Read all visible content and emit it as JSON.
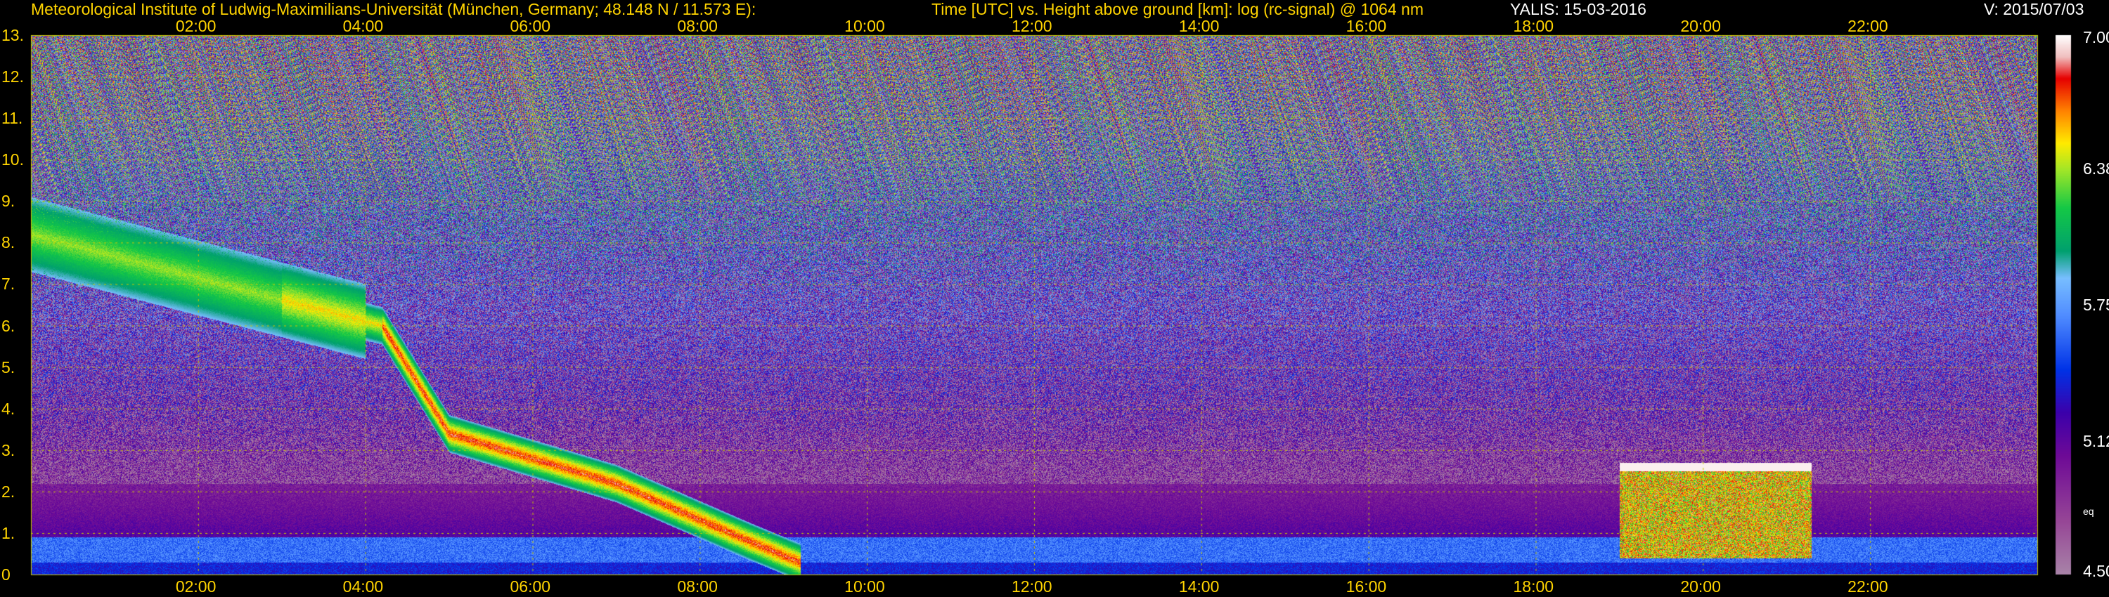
{
  "header": {
    "institute": "Meteorological Institute of Ludwig-Maximilians-Universität (München, Germany; 48.148 N / 11.573 E):",
    "plot_desc": "Time [UTC] vs. Height above ground [km]: log (rc-signal) @ 1064 nm",
    "instrument": "YALIS: 15-03-2016",
    "version": "V: 2015/07/03"
  },
  "colors": {
    "annotation": "#ffd400",
    "grid": "#c8c800",
    "background": "#000000"
  },
  "chart_data": {
    "type": "heatmap",
    "x_unit": "UTC hour",
    "y_unit": "km",
    "xlim": [
      0,
      24
    ],
    "ylim": [
      0,
      13
    ],
    "x_ticks": [
      2,
      4,
      6,
      8,
      10,
      12,
      14,
      16,
      18,
      20,
      22
    ],
    "x_tick_labels": [
      "02:00",
      "04:00",
      "06:00",
      "08:00",
      "10:00",
      "12:00",
      "14:00",
      "16:00",
      "18:00",
      "20:00",
      "22:00"
    ],
    "y_ticks": [
      0,
      1,
      2,
      3,
      4,
      5,
      6,
      7,
      8,
      9,
      10,
      11,
      12,
      13
    ],
    "y_tick_labels": [
      "0",
      "1.",
      "2.",
      "3.",
      "4.",
      "5.",
      "6.",
      "7.",
      "8.",
      "9.",
      "10.",
      "11.",
      "12.",
      "13."
    ],
    "grid": true,
    "colorbar": {
      "range": [
        4.5,
        7.0
      ],
      "tick_values": [
        7.0,
        6.38,
        5.75,
        5.12,
        4.5
      ],
      "tick_labels": [
        "7.00",
        "6.38",
        "5.75",
        "5.12",
        "4.50"
      ],
      "unit_label": "eq"
    },
    "features": [
      {
        "kind": "descending_layer",
        "time": [
          0.0,
          4.2,
          5.0,
          6.0,
          7.0,
          7.8,
          8.6,
          9.2
        ],
        "height_km": [
          8.2,
          6.0,
          3.4,
          2.8,
          2.2,
          1.5,
          0.8,
          0.3
        ]
      },
      {
        "kind": "near_surface_layer",
        "time": [
          0,
          24
        ],
        "height_km": [
          0.3,
          0.9
        ]
      },
      {
        "kind": "cloud_block",
        "time": [
          19.0,
          21.3
        ],
        "height_km": [
          0.4,
          2.7
        ]
      }
    ]
  }
}
